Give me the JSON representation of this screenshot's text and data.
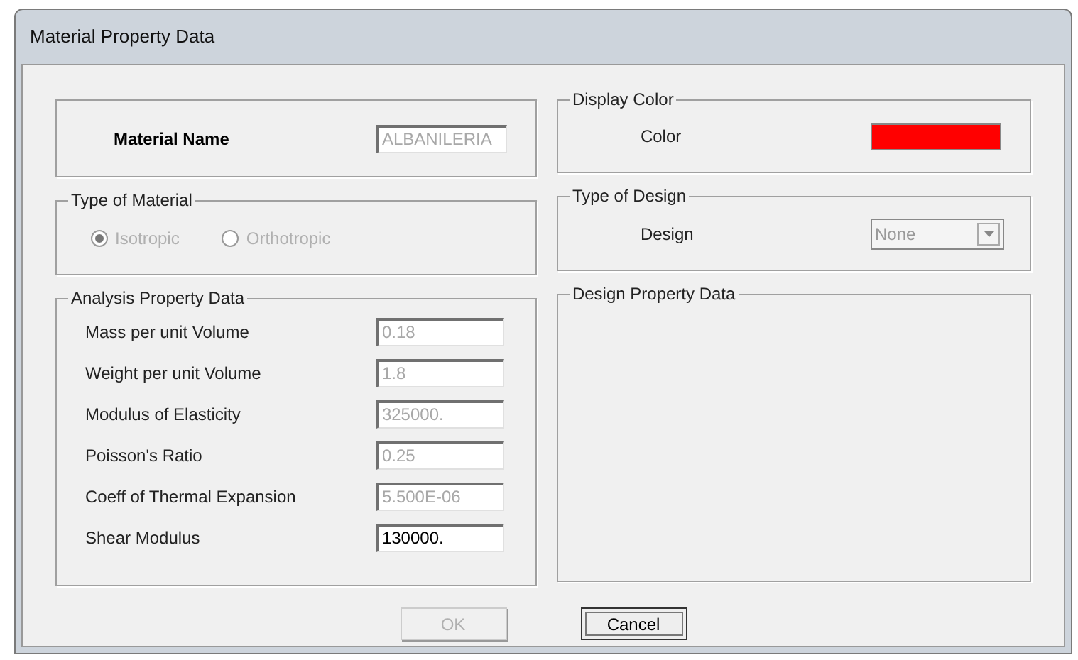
{
  "window": {
    "title": "Material Property Data"
  },
  "material_name": {
    "label": "Material Name",
    "value": "ALBANILERIA"
  },
  "type_of_material": {
    "title": "Type of Material",
    "options": [
      {
        "label": "Isotropic",
        "selected": true,
        "disabled": true
      },
      {
        "label": "Orthotropic",
        "selected": false,
        "disabled": true
      }
    ]
  },
  "analysis_property_data": {
    "title": "Analysis Property Data",
    "fields": [
      {
        "label": "Mass per unit Volume",
        "value": "0.18",
        "disabled": true
      },
      {
        "label": "Weight per unit Volume",
        "value": "1.8",
        "disabled": true
      },
      {
        "label": "Modulus of Elasticity",
        "value": "325000.",
        "disabled": true
      },
      {
        "label": "Poisson's Ratio",
        "value": "0.25",
        "disabled": true
      },
      {
        "label": "Coeff of Thermal Expansion",
        "value": "5.500E-06",
        "disabled": true
      },
      {
        "label": "Shear Modulus",
        "value": "130000.",
        "disabled": false
      }
    ]
  },
  "display_color": {
    "title": "Display Color",
    "label": "Color",
    "color": "#ff0000"
  },
  "type_of_design": {
    "title": "Type of Design",
    "label": "Design",
    "value": "None"
  },
  "design_property_data": {
    "title": "Design Property Data"
  },
  "buttons": [
    {
      "label": "OK",
      "disabled": true
    },
    {
      "label": "Cancel",
      "disabled": false
    }
  ]
}
